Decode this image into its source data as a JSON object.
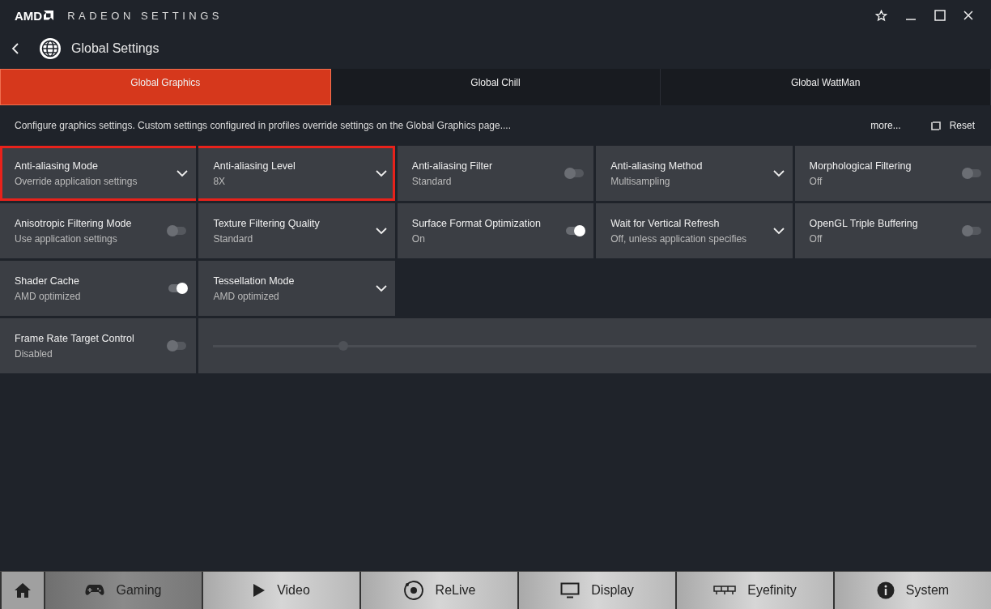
{
  "window": {
    "brand": "AMD",
    "title": "RADEON SETTINGS"
  },
  "header": {
    "title": "Global Settings"
  },
  "tabs": [
    {
      "label": "Global Graphics",
      "selected": true
    },
    {
      "label": "Global Chill",
      "selected": false
    },
    {
      "label": "Global WattMan",
      "selected": false
    }
  ],
  "description": "Configure graphics settings. Custom settings configured in profiles override settings on the Global Graphics page....",
  "more_link": "more...",
  "reset_button": "Reset",
  "rows": [
    {
      "tiles": [
        {
          "kind": "dropdown",
          "label": "Anti-aliasing Mode",
          "value": "Override application settings",
          "highlighted": true
        },
        {
          "kind": "dropdown",
          "label": "Anti-aliasing Level",
          "value": "8X",
          "highlighted": true
        },
        {
          "kind": "toggle",
          "label": "Anti-aliasing Filter",
          "value": "Standard",
          "on": false,
          "highlighted": false
        },
        {
          "kind": "dropdown",
          "label": "Anti-aliasing Method",
          "value": "Multisampling",
          "highlighted": false
        },
        {
          "kind": "toggle",
          "label": "Morphological Filtering",
          "value": "Off",
          "on": false,
          "highlighted": false
        }
      ]
    },
    {
      "tiles": [
        {
          "kind": "toggle",
          "label": "Anisotropic Filtering Mode",
          "value": "Use application settings",
          "on": false,
          "highlighted": false
        },
        {
          "kind": "dropdown",
          "label": "Texture Filtering Quality",
          "value": "Standard",
          "highlighted": false
        },
        {
          "kind": "toggle",
          "label": "Surface Format Optimization",
          "value": "On",
          "on": true,
          "highlighted": false
        },
        {
          "kind": "dropdown",
          "label": "Wait for Vertical Refresh",
          "value": "Off, unless application specifies",
          "highlighted": false
        },
        {
          "kind": "toggle",
          "label": "OpenGL Triple Buffering",
          "value": "Off",
          "on": false,
          "highlighted": false
        }
      ]
    },
    {
      "tiles": [
        {
          "kind": "toggle",
          "label": "Shader Cache",
          "value": "AMD optimized",
          "on": true,
          "highlighted": false
        },
        {
          "kind": "dropdown",
          "label": "Tessellation Mode",
          "value": "AMD optimized",
          "highlighted": false
        }
      ]
    },
    {
      "tiles": [
        {
          "kind": "toggle",
          "label": "Frame Rate Target Control",
          "value": "Disabled",
          "on": false,
          "highlighted": false
        },
        {
          "kind": "slider",
          "level": 0.17,
          "disabled": true,
          "highlighted": false
        }
      ]
    }
  ],
  "bottom_nav": [
    {
      "kind": "home",
      "selected": false
    },
    {
      "kind": "gamepad",
      "label": "Gaming",
      "selected": true
    },
    {
      "kind": "play",
      "label": "Video",
      "selected": false
    },
    {
      "kind": "relive",
      "label": "ReLive",
      "selected": false
    },
    {
      "kind": "monitor",
      "label": "Display",
      "selected": false
    },
    {
      "kind": "eyefinity",
      "label": "Eyefinity",
      "selected": false
    },
    {
      "kind": "info",
      "label": "System",
      "selected": false
    }
  ]
}
